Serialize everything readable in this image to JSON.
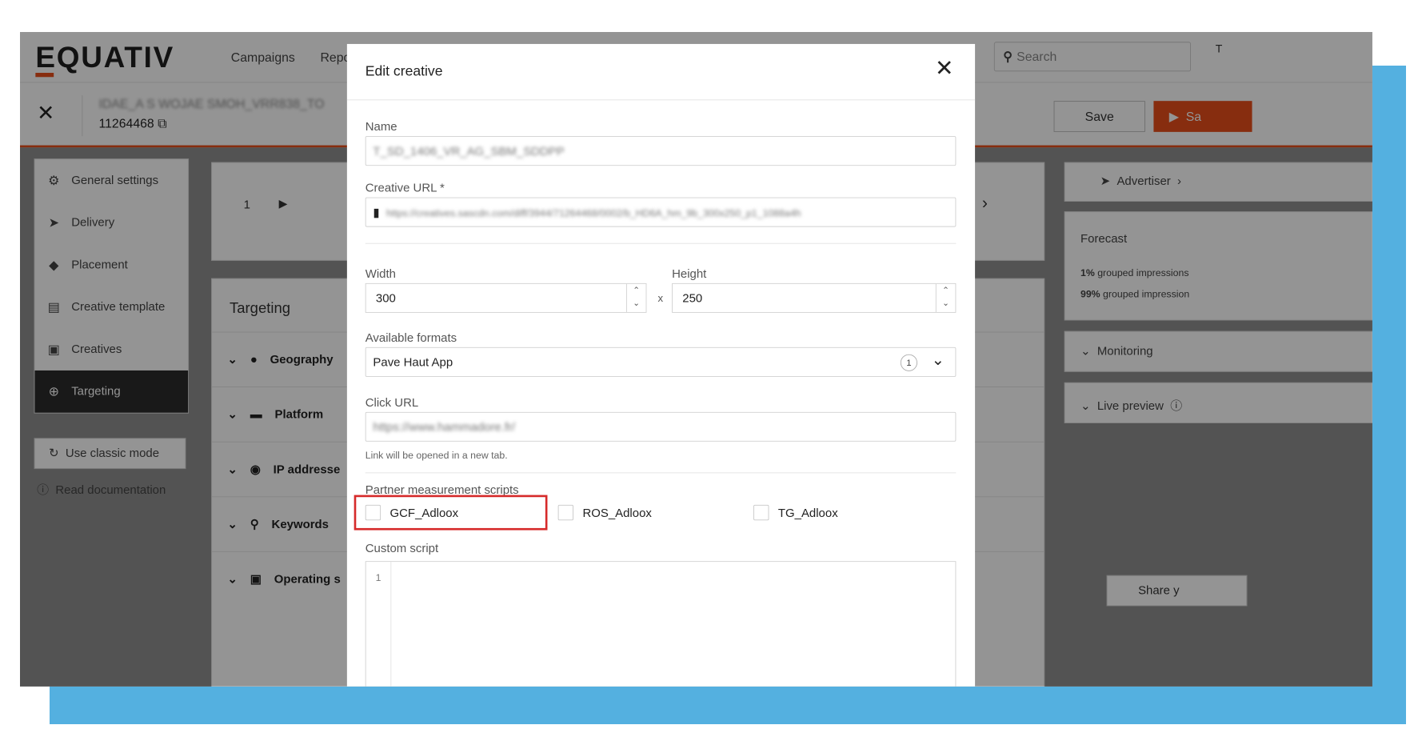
{
  "app": {
    "logo": "EQUATIV",
    "nav": [
      "Campaigns",
      "Repo"
    ],
    "search_placeholder": "Search",
    "user_initial": "T"
  },
  "insertion": {
    "title_blurred": "IDAE_A S WOJAE SMOH_VRR838_TO",
    "id": "11264468",
    "save_label": "Save",
    "save_publish_label": "Sa"
  },
  "sidebar": {
    "items": [
      {
        "label": "General settings",
        "icon": "gear-icon"
      },
      {
        "label": "Delivery",
        "icon": "send-icon"
      },
      {
        "label": "Placement",
        "icon": "layers-icon"
      },
      {
        "label": "Creative template",
        "icon": "template-icon"
      },
      {
        "label": "Creatives",
        "icon": "creatives-icon"
      },
      {
        "label": "Targeting",
        "icon": "crosshair-icon",
        "active": true
      }
    ],
    "classic_mode": "Use classic mode",
    "read_doc": "Read documentation"
  },
  "creative_strip": {
    "index": "1"
  },
  "targeting": {
    "title": "Targeting",
    "rows": [
      "Geography",
      "Platform",
      "IP addresse",
      "Keywords",
      "Operating s"
    ]
  },
  "right_panel": {
    "advertiser": "Advertiser",
    "forecast_title": "Forecast",
    "forecast_line1_pct": "1%",
    "forecast_line1_text": "grouped impressions",
    "forecast_line2_pct": "99%",
    "forecast_line2_text": "grouped impression",
    "monitoring": "Monitoring",
    "live_preview": "Live preview",
    "share": "Share y"
  },
  "modal": {
    "title": "Edit creative",
    "name_label": "Name",
    "name_value": "T_SD_1406_VR_AG_SBM_SDDPP",
    "url_label": "Creative URL *",
    "url_value": "https://creatives.sascdn.com/diff/3944/71264468/0002/b_HD6A_hm_9b_300x250_p1_1088a4h",
    "width_label": "Width",
    "width_value": "300",
    "height_label": "Height",
    "height_value": "250",
    "x_sep": "x",
    "formats_label": "Available formats",
    "formats_value": "Pave Haut App",
    "formats_count": "1",
    "click_label": "Click URL",
    "click_value": "https://www.hammadore.fr/",
    "click_hint": "Link will be opened in a new tab.",
    "partner_label": "Partner measurement scripts",
    "scripts": [
      "GCF_Adloox",
      "ROS_Adloox",
      "TG_Adloox"
    ],
    "custom_label": "Custom script",
    "code_line": "1"
  },
  "colors": {
    "brand": "#e84e1b",
    "frame": "#54b0e0",
    "highlight": "#d62b2b"
  }
}
